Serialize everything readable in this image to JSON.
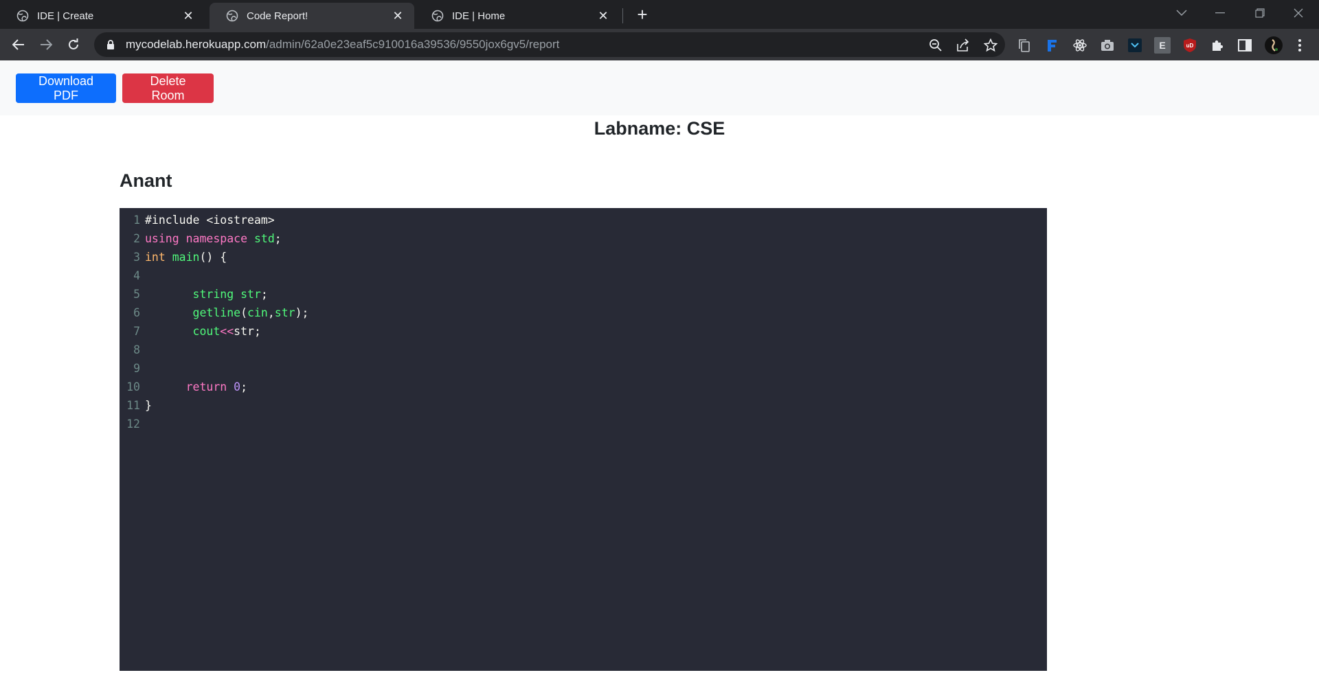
{
  "browser": {
    "tabs": [
      {
        "title": "IDE | Create",
        "active": false
      },
      {
        "title": "Code Report!",
        "active": true
      },
      {
        "title": "IDE | Home",
        "active": false
      }
    ],
    "url_host": "mycodelab.herokuapp.com",
    "url_path": "/admin/62a0e23eaf5c910016a39536/9550jox6gv5/report",
    "extensions": [
      "copy-icon",
      "feedly-icon",
      "react-devtools-icon",
      "camera-icon",
      "vscode-icon",
      "E",
      "uD",
      "puzzle-icon",
      "sidebar-icon",
      "avatar"
    ]
  },
  "actions": {
    "download_label": "Download PDF",
    "delete_label": "Delete Room"
  },
  "report": {
    "labname": "Labname: CSE",
    "student": "Anant"
  },
  "code_lines": [
    {
      "n": "1",
      "text": "#include <iostream>"
    },
    {
      "n": "2",
      "text": "using namespace std;"
    },
    {
      "n": "3",
      "text": "int main() {"
    },
    {
      "n": "4",
      "text": ""
    },
    {
      "n": "5",
      "text": "       string str;"
    },
    {
      "n": "6",
      "text": "       getline(cin,str);"
    },
    {
      "n": "7",
      "text": "       cout<<str;"
    },
    {
      "n": "8",
      "text": ""
    },
    {
      "n": "9",
      "text": ""
    },
    {
      "n": "10",
      "text": "      return 0;"
    },
    {
      "n": "11",
      "text": "}"
    },
    {
      "n": "12",
      "text": ""
    }
  ],
  "colors": {
    "editor_bg": "#282a36",
    "primary": "#0d6efd",
    "danger": "#dc3545"
  }
}
